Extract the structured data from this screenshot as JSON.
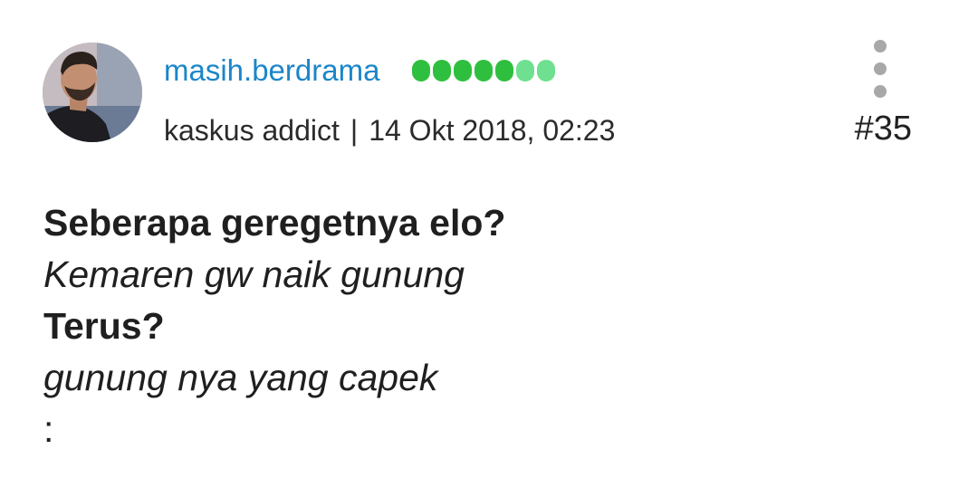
{
  "post": {
    "author": {
      "username": "masih.berdrama",
      "rank": "kaskus addict",
      "reputation_dots": [
        "full",
        "full",
        "full",
        "full",
        "full",
        "light",
        "light"
      ]
    },
    "separator": "|",
    "timestamp": "14 Okt 2018, 02:23",
    "post_number": "#35",
    "content_lines": [
      {
        "text": "Seberapa geregetnya elo?",
        "style": "bold"
      },
      {
        "text": "Kemaren gw naik gunung",
        "style": "italic"
      },
      {
        "text": "Terus?",
        "style": "bold"
      },
      {
        "text": "gunung nya yang capek",
        "style": "italic"
      },
      {
        "text": ":",
        "style": "normal"
      }
    ]
  },
  "colors": {
    "username": "#1b86c9",
    "rep_full": "#2fbf3f",
    "rep_light": "#6fe08f",
    "menu_dots": "#a8a8a8"
  },
  "icons": {
    "more_menu": "vertical-ellipsis-icon"
  }
}
